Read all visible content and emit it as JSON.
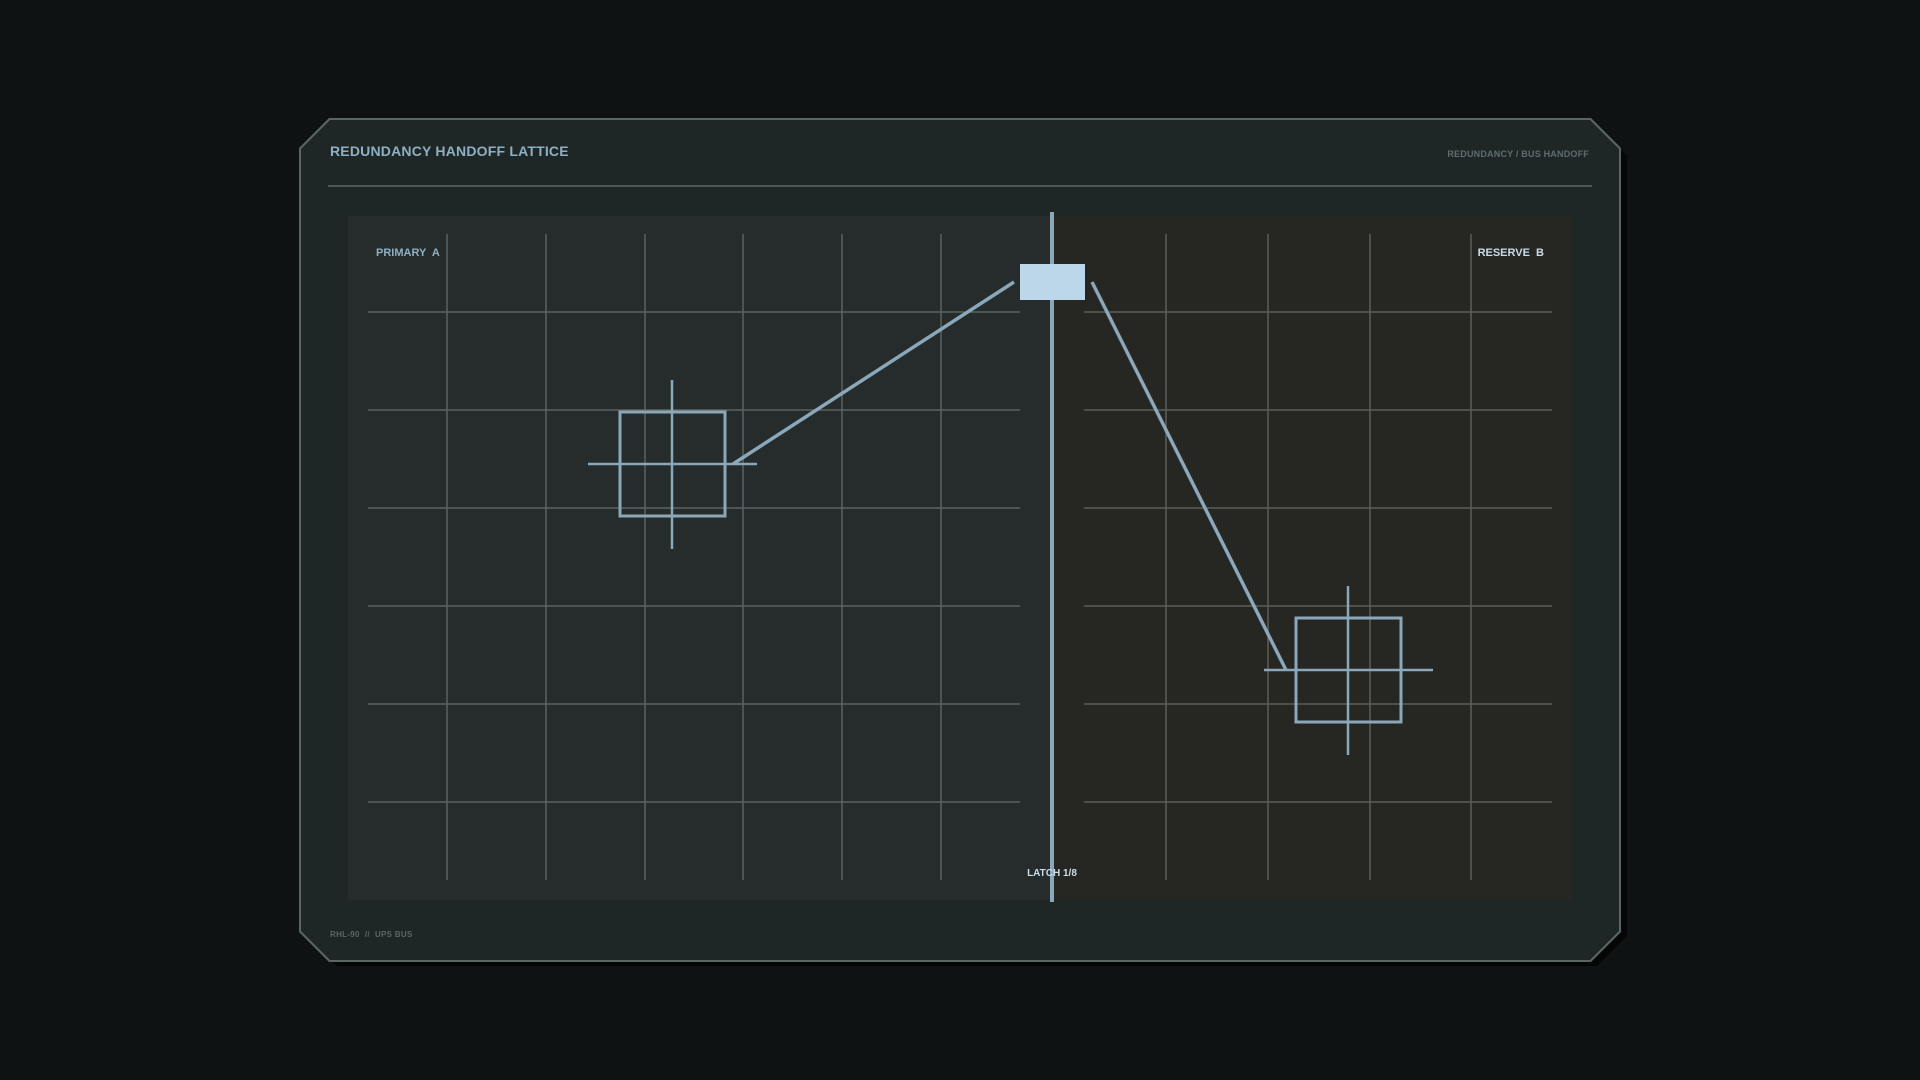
{
  "header": {
    "title": "REDUNDANCY HANDOFF LATTICE",
    "subtitle": "REDUNDANCY / BUS HANDOFF"
  },
  "zones": {
    "primary_label": "PRIMARY  A",
    "reserve_label": "RESERVE  B"
  },
  "latch": {
    "label": "LATCH 1/8"
  },
  "footer": {
    "text": "RHL-90  //  UPS BUS"
  },
  "colors": {
    "accent": "#8fb0c4",
    "latch_fill": "#bcd6ea",
    "primary_bg": "#252c2b",
    "reserve_bg": "#262623",
    "panel_bg": "#1f2626",
    "grid": "#59635f"
  }
}
